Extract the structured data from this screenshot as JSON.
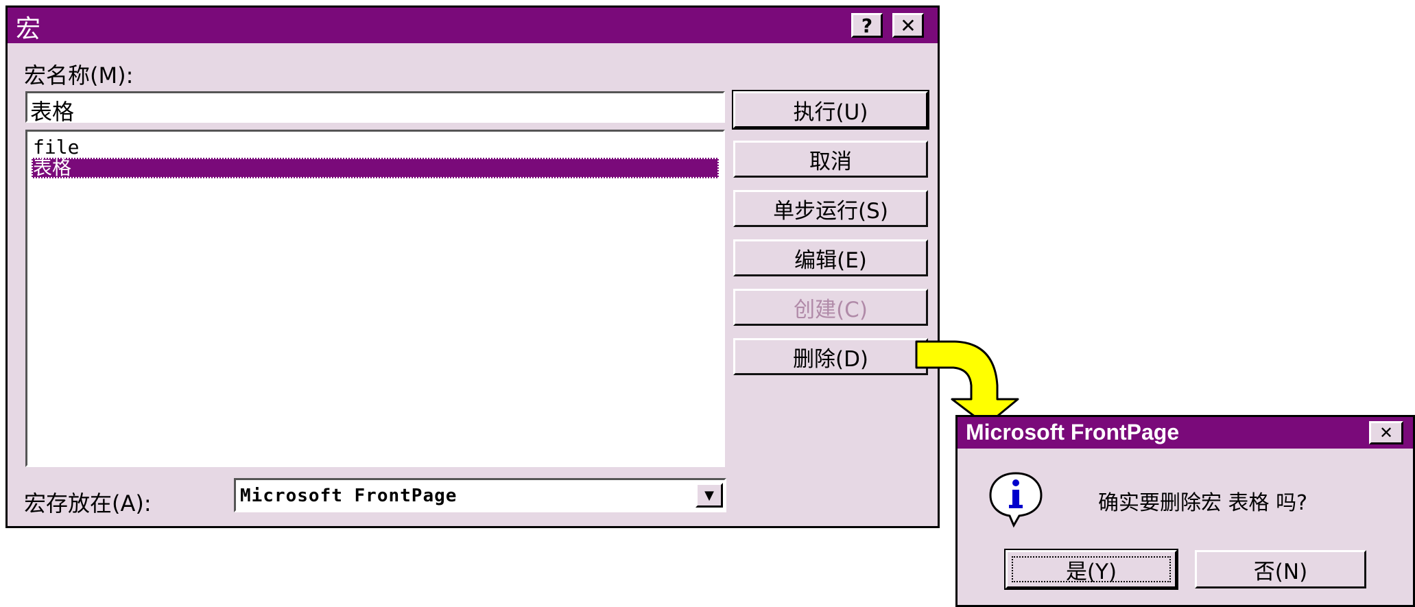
{
  "macro_dialog": {
    "title": "宏",
    "help_button": "?",
    "close_button": "✕",
    "macro_name_label": "宏名称(M):",
    "macro_name_value": "表格",
    "macro_list": [
      "file",
      "表格"
    ],
    "selected_index": 1,
    "buttons": {
      "run": "执行(U)",
      "cancel": "取消",
      "step_into": "单步运行(S)",
      "edit": "编辑(E)",
      "create": "创建(C)",
      "delete": "删除(D)"
    },
    "macros_in_label": "宏存放在(A):",
    "macros_in_value": "Microsoft FrontPage",
    "dropdown_arrow": "▼"
  },
  "confirm_dialog": {
    "title": "Microsoft FrontPage",
    "close_button": "✕",
    "icon": "info-icon",
    "message": "确实要删除宏 表格 吗?",
    "yes_button": "是(Y)",
    "no_button": "否(N)"
  },
  "colors": {
    "titlebar": "#7a0a7a",
    "dialog_bg": "#e6d8e4",
    "arrow": "#ffff00"
  }
}
